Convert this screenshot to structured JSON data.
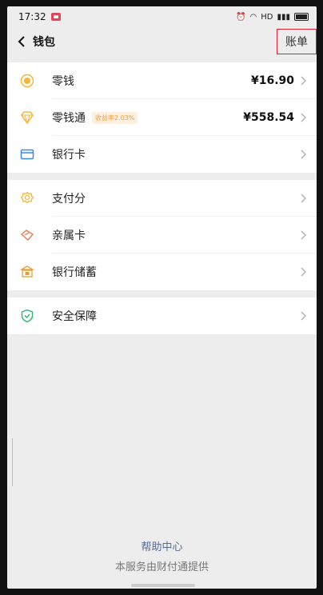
{
  "status": {
    "time": "17:32",
    "right_text": "HD"
  },
  "nav": {
    "title": "钱包",
    "bill_label": "账单"
  },
  "groups": [
    {
      "items": [
        {
          "label": "零钱",
          "value": "¥16.90",
          "icon": "coin-icon",
          "color": "#f5b63b"
        },
        {
          "label": "零钱通",
          "badge": "收益率2.03%",
          "value": "¥558.54",
          "icon": "diamond-icon",
          "color": "#f5b63b"
        },
        {
          "label": "银行卡",
          "icon": "bank-card-icon",
          "color": "#3b86e8"
        }
      ]
    },
    {
      "items": [
        {
          "label": "支付分",
          "icon": "pay-score-icon",
          "color": "#f5b63b"
        },
        {
          "label": "亲属卡",
          "icon": "family-card-icon",
          "color": "#f07a4a"
        },
        {
          "label": "银行储蓄",
          "icon": "bank-savings-icon",
          "color": "#e0a036"
        }
      ]
    },
    {
      "items": [
        {
          "label": "安全保障",
          "icon": "shield-icon",
          "color": "#2bb673"
        }
      ]
    }
  ],
  "footer": {
    "help": "帮助中心",
    "provider": "本服务由财付通提供"
  }
}
